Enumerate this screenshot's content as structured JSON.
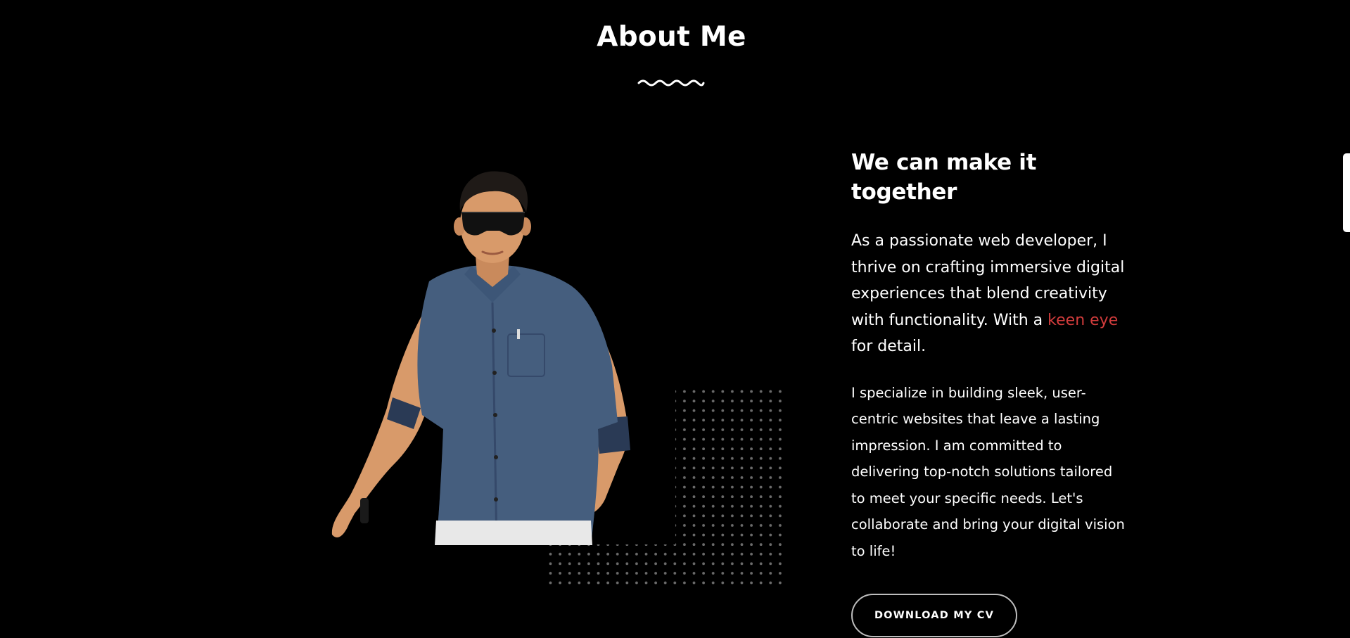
{
  "section": {
    "title": "About Me"
  },
  "about": {
    "heading": "We can make it together",
    "lead_before": "As a passionate web developer, I thrive on crafting immersive digital experiences that blend creativity with functionality. With a ",
    "lead_highlight": "keen eye",
    "lead_after": " for detail.",
    "body": "I specialize in building sleek, user-centric websites that leave a lasting impression. I am committed to delivering top-notch solutions tailored to meet your specific needs. Let's collaborate and bring your digital vision to life!",
    "cv_button": "DOWNLOAD MY CV"
  },
  "colors": {
    "background": "#000000",
    "text": "#ffffff",
    "accent": "#d23c3c",
    "dots": "#6b6b6b"
  }
}
